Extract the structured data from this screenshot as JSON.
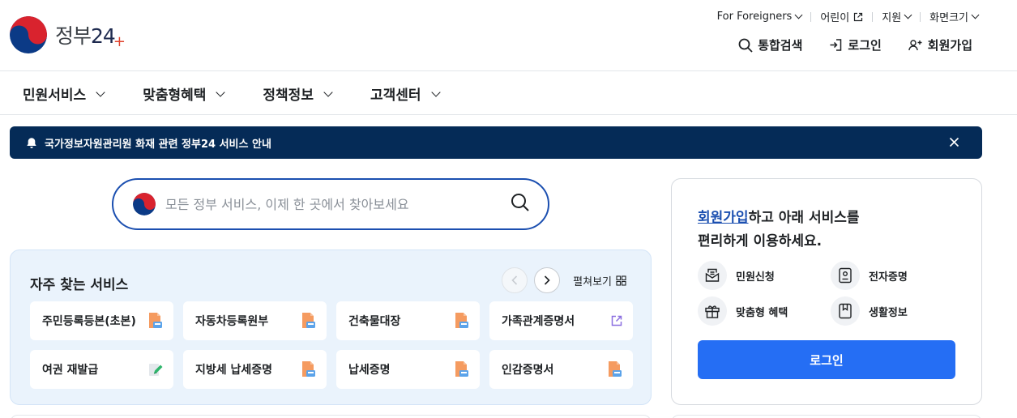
{
  "brand": {
    "name_prefix": "정부",
    "name_number": "24",
    "plus_mark": "+"
  },
  "util_nav": [
    {
      "label": "For Foreigners",
      "icon": "chevron-down-icon"
    },
    {
      "label": "어린이",
      "icon": "external-link-icon"
    },
    {
      "label": "지원",
      "icon": "chevron-down-icon"
    },
    {
      "label": "화면크기",
      "icon": "chevron-down-icon"
    }
  ],
  "header_actions": [
    {
      "label": "통합검색",
      "icon": "search-icon"
    },
    {
      "label": "로그인",
      "icon": "login-icon"
    },
    {
      "label": "회원가입",
      "icon": "user-plus-icon"
    }
  ],
  "gnb": [
    {
      "label": "민원서비스"
    },
    {
      "label": "맞춤형혜택"
    },
    {
      "label": "정책정보"
    },
    {
      "label": "고객센터"
    }
  ],
  "notice": {
    "text": "국가정보자원관리원 화재 관련 정부24 서비스 안내"
  },
  "search": {
    "placeholder": "모든 정부 서비스, 이제 한 곳에서 찾아보세요"
  },
  "frequent": {
    "title": "자주 찾는 서비스",
    "expand_label": "펼쳐보기",
    "items": [
      {
        "label": "주민등록등본(초본)",
        "icon": "document-print-icon"
      },
      {
        "label": "자동차등록원부",
        "icon": "document-print-icon"
      },
      {
        "label": "건축물대장",
        "icon": "document-print-icon"
      },
      {
        "label": "가족관계증명서",
        "icon": "external-link-icon"
      },
      {
        "label": "여권 재발급",
        "icon": "edit-document-icon"
      },
      {
        "label": "지방세 납세증명",
        "icon": "document-print-icon"
      },
      {
        "label": "납세증명",
        "icon": "document-print-icon"
      },
      {
        "label": "인감증명서",
        "icon": "document-print-icon"
      }
    ]
  },
  "member_panel": {
    "title_link": "회원가입",
    "title_rest": "하고 아래 서비스를",
    "title_line2": "편리하게 이용하세요.",
    "services": [
      {
        "label": "민원신청",
        "icon": "mail-tray-icon"
      },
      {
        "label": "전자증명",
        "icon": "id-certificate-icon"
      },
      {
        "label": "맞춤형 혜택",
        "icon": "gift-icon"
      },
      {
        "label": "생활정보",
        "icon": "bookmark-icon"
      }
    ],
    "login_label": "로그인"
  },
  "colors": {
    "navy": "#052b57",
    "primary": "#256ef4",
    "link": "#1b4fb0",
    "panel_bg": "#eaf3fc"
  }
}
